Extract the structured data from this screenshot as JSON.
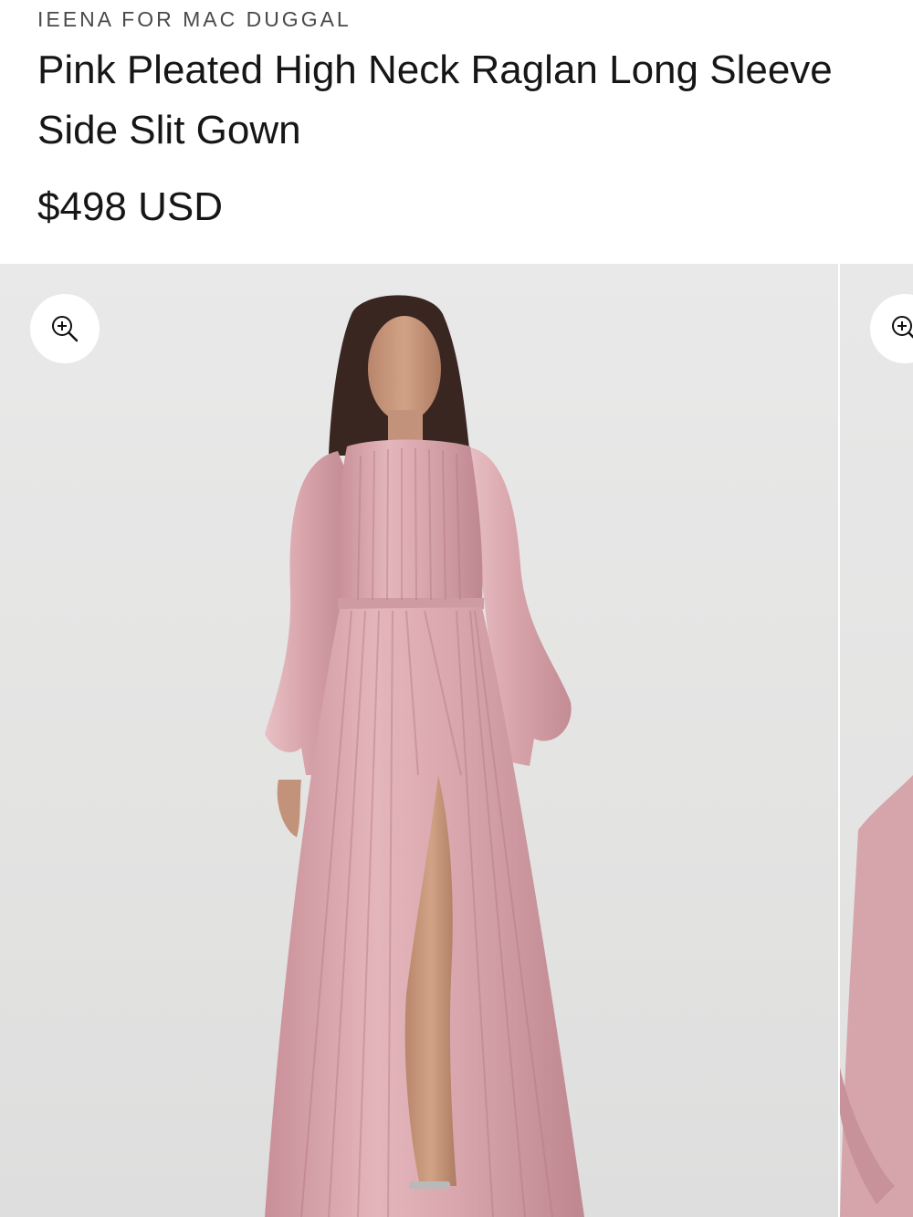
{
  "product": {
    "vendor": "IEENA FOR MAC DUGGAL",
    "title": "Pink Pleated High Neck Raglan Long Sleeve Side Slit Gown",
    "price": "$498 USD"
  },
  "gallery": {
    "zoom_icon": "zoom-in-icon",
    "colors": {
      "background": "#e6e6e5",
      "gown": "#d9a8ae",
      "gown_shadow": "#b98189",
      "hair": "#3a2620",
      "skin": "#c89a80"
    }
  }
}
